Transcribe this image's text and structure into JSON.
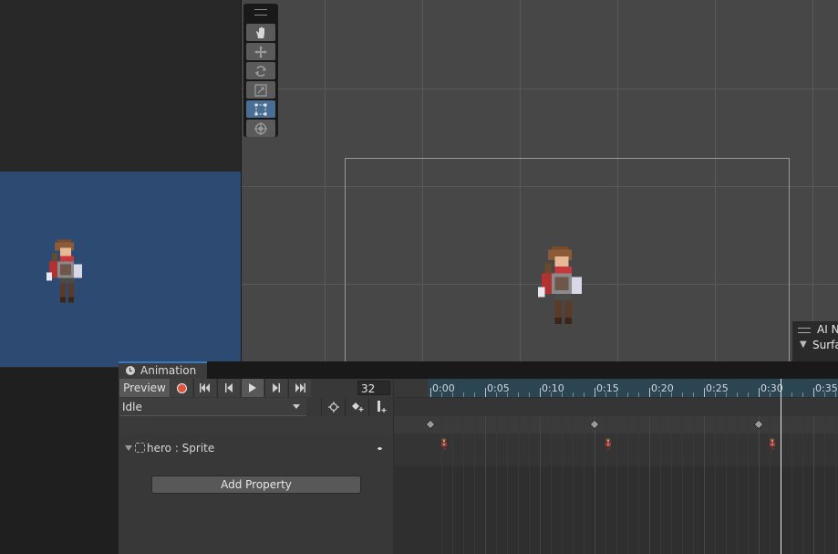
{
  "scene": {
    "tools": [
      "hand-tool",
      "move-tool",
      "rotate-tool",
      "scale-tool",
      "rect-tool",
      "transform-tool"
    ],
    "active_tool": "rect-tool",
    "ai_nav": {
      "title": "AI N",
      "surface": "Surfa"
    }
  },
  "animation": {
    "tab_label": "Animation",
    "preview_label": "Preview",
    "frame": "32",
    "clip_name": "Idle",
    "ruler_ticks": [
      "0:00",
      "0:05",
      "0:10",
      "0:15",
      "0:20",
      "0:25",
      "0:30",
      "0:35"
    ],
    "property_label": "hero : Sprite",
    "add_property_label": "Add Property",
    "keyframe_times": [
      "0:00",
      "0:15",
      "0:30"
    ]
  },
  "colors": {
    "game_background": "#2d4a72",
    "record": "#e0533f",
    "active_tool": "#4a6d93",
    "playhead": "#e8e8e8"
  }
}
